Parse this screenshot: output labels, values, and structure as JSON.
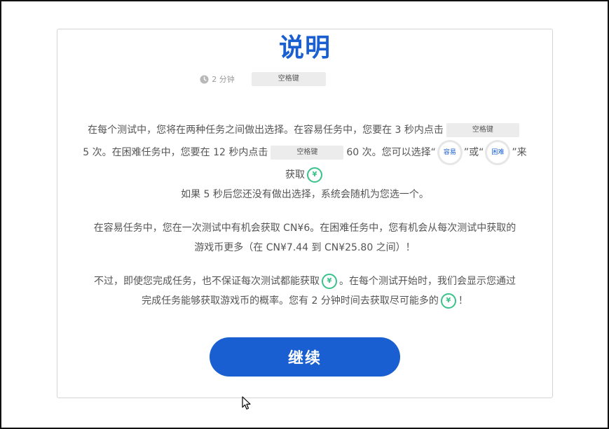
{
  "title": "说明",
  "meta": {
    "time": "2 分钟",
    "key_label": "空格键",
    "icon": "clock-icon"
  },
  "paragraph1": {
    "l1_a": "在每个测试中，您将在两种任务之间做出选择。在容易任务中，您要在 3 秒内点击",
    "key1": "空格键",
    "l2_a": "5 次。在困难任务中，您要在 12 秒内点击",
    "key2": "空格键",
    "l2_b": "60 次。您可以选择“",
    "easy_pill": "容易",
    "l2_c": "”或“",
    "hard_pill": "困难",
    "l2_d": "”来",
    "l3_a": "获取",
    "l4": "如果 5 秒后您还没有做出选择，系统会随机为您选一个。"
  },
  "paragraph2": {
    "l1": "在容易任务中，您在一次测试中有机会获取 CN¥6。在困难任务中，您有机会从每次测试中获取的",
    "l2": "游戏币更多（在 CN¥7.44 到 CN¥25.80 之间）！"
  },
  "paragraph3": {
    "l1_a": "不过，即使您完成任务，也不保证每次测试都能获取",
    "l1_b": "。在每个测试开始时，我们会显示您通过",
    "l2_a": "完成任务能够获取游戏币的概率。您有 2 分钟时间去获取尽可能多的",
    "l2_b": "！"
  },
  "coin_symbol": "¥",
  "continue_label": "继续",
  "colors": {
    "accent": "#1a5fd1",
    "coin": "#39c28a",
    "text": "#555555",
    "chip": "#ececec"
  }
}
